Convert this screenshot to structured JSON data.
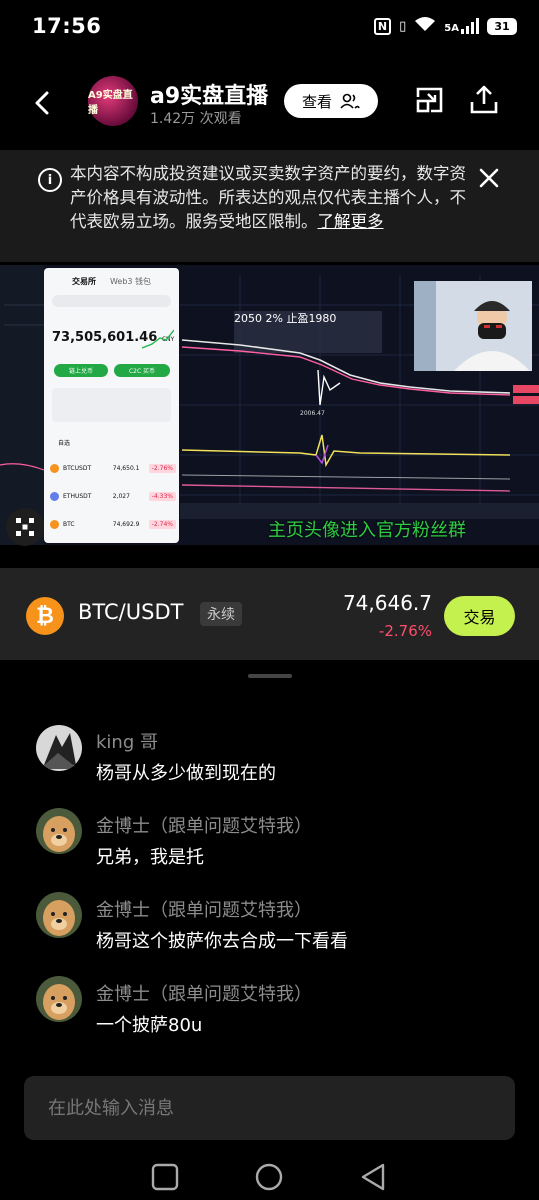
{
  "status": {
    "time": "17:56",
    "net": "5A",
    "battery": "31"
  },
  "header": {
    "channel_name": "a9实盘直播",
    "avatar_text": "A9实盘直播",
    "viewers": "1.42万 次观看",
    "view_button": "查看"
  },
  "disclaimer": {
    "text": "本内容不构成投资建议或买卖数字资产的要约，数字资产价格具有波动性。所表达的观点仅代表主播个人，不代表欧易立场。服务受地区限制。",
    "link": "了解更多"
  },
  "video": {
    "app_tab_active": "交易所",
    "app_tab_other": "Web3 钱包",
    "balance": "73,505,601.46",
    "balance_unit": "CNY",
    "btn_primary": "链上兑币",
    "btn_secondary": "C2C 买币",
    "list_tab": "自选",
    "rows": [
      {
        "sym": "BTCUSDT",
        "price": "74,650.1",
        "chg": "-2.76%"
      },
      {
        "sym": "ETHUSDT",
        "price": "2,027",
        "chg": "-4.33%"
      },
      {
        "sym": "BTC",
        "price": "74,692.9",
        "chg": "-2.74%"
      }
    ],
    "chart_note": "2050 2%  止盈1980",
    "chart_low": "2006.47",
    "overlay_text": "主页头像进入官方粉丝群"
  },
  "ticker": {
    "pair": "BTC/USDT",
    "tag": "永续",
    "price": "74,646.7",
    "change": "-2.76%",
    "trade_button": "交易",
    "colors": {
      "up": "#c4f14e",
      "down": "#ff4d6a",
      "coin": "#f7931a"
    }
  },
  "chat": [
    {
      "name": "king 哥",
      "message": "杨哥从多少做到现在的",
      "avatar": "dark"
    },
    {
      "name": "金博士（跟单问题艾特我）",
      "message": "兄弟，我是托",
      "avatar": "dog"
    },
    {
      "name": "金博士（跟单问题艾特我）",
      "message": "杨哥这个披萨你去合成一下看看",
      "avatar": "dog"
    },
    {
      "name": "金博士（跟单问题艾特我）",
      "message": "一个披萨80u",
      "avatar": "dog"
    }
  ],
  "input": {
    "placeholder": "在此处输入消息"
  }
}
